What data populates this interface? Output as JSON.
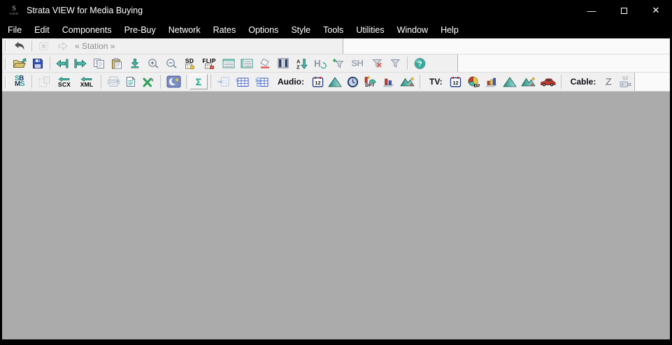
{
  "window": {
    "title": "Strata VIEW for Media Buying",
    "app_icon": {
      "top": "S",
      "bottom": "VIEW"
    },
    "controls": {
      "minimize": "—",
      "close": "✕"
    }
  },
  "menu": {
    "items": [
      "File",
      "Edit",
      "Components",
      "Pre-Buy",
      "Network",
      "Rates",
      "Options",
      "Style",
      "Tools",
      "Utilities",
      "Window",
      "Help"
    ]
  },
  "station_bar": {
    "label": "« Station »"
  },
  "main_bar": {
    "sd": "SD",
    "flip": "FLIP",
    "sort_a": "A",
    "sort_z": "Z",
    "h": "H",
    "sh": "SH",
    "help": "?"
  },
  "component_bar": {
    "sbms": {
      "s1": "S",
      "b": "B",
      "m": "M",
      "s2": "S"
    },
    "scx": "SCX",
    "xml": "XML",
    "sigma": "Σ",
    "audio_label": "Audio:",
    "tv_label": "TV:",
    "cable_label": "Cable:",
    "calendar_day": "12",
    "dpt": "DPT",
    "dp": "DP",
    "z": "Z",
    "sz": "SZ"
  },
  "colors": {
    "titlebar": "#000000",
    "toolbar_band": "#f0f0f0",
    "toolbar_back": "#fafafa",
    "workspace": "#ababab",
    "accent_teal": "#3aaf9f",
    "navy": "#1f3864",
    "disabled": "#cdcdcd",
    "folder_tan": "#e6d389",
    "save_blue": "#3a57c6",
    "alert_red": "#c23b2e",
    "star_yellow": "#e8c93e"
  },
  "icons": [
    "app-logo",
    "minimize",
    "maximize",
    "close",
    "undo",
    "cancel-box",
    "go-arrow",
    "folder-open",
    "save",
    "arrow-left-bar",
    "arrow-right-bar",
    "copy",
    "paste",
    "arrow-down-to-line",
    "zoom-in",
    "zoom-out",
    "sd-grid",
    "flip-grid",
    "rows",
    "rows-alt",
    "eraser",
    "columns",
    "sort-az",
    "h-refresh",
    "funnel-plus",
    "show-hidden",
    "funnel-x",
    "funnel",
    "help",
    "sbms-logo",
    "dotted-grid",
    "scx-import",
    "xml-import",
    "printer",
    "document",
    "excel-x",
    "moon",
    "sigma",
    "grid-arrow",
    "table-sparkle",
    "table-sparkle-alt",
    "calendar-12",
    "triangle",
    "clock",
    "dpt-chart",
    "bar-chart",
    "area-chart",
    "pie-chart-dp",
    "car",
    "z-letter",
    "sz-camera"
  ]
}
